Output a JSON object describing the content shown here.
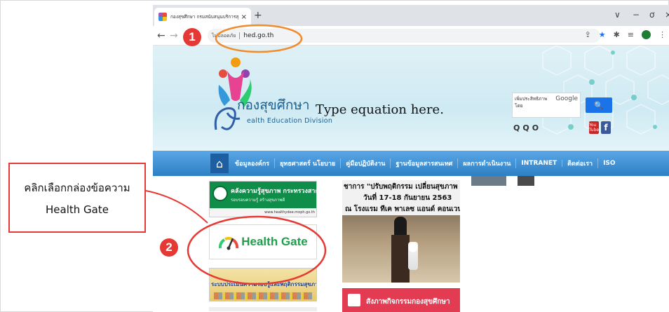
{
  "browser": {
    "tab_title": "กองสุขศึกษา กรมสนับสนุนบริการสุขภ",
    "tab_close": "×",
    "new_tab": "+",
    "window_controls": [
      "∨",
      "−",
      "ơ",
      "×"
    ],
    "nav": {
      "back": "←",
      "forward": "→"
    },
    "security_label": "ไม่ปลอดภัย",
    "url": "hed.go.th",
    "toolbar_icons": [
      "share-icon",
      "star-icon",
      "extension-icon",
      "reading-list-icon",
      "profile-icon",
      "more-icon"
    ]
  },
  "site": {
    "logo_thai": "กองสุขศึกษา",
    "logo_english": "ealth Education Division",
    "equation_placeholder": "Type equation here.",
    "search_placeholder": "เพิ่มประสิทธิภาพโดย",
    "search_brand": "Google",
    "search_button": "🔍",
    "zoom_buttons": [
      "Q",
      "Q",
      "O"
    ],
    "social": {
      "youtube": "You Tube",
      "facebook": "f"
    },
    "menu": [
      "ข้อมูลองค์กร",
      "ยุทธศาสตร์ นโยบาย",
      "คู่มือปฏิบัติงาน",
      "ฐานข้อมูลสารสนเทศ",
      "ผลการดำเนินงาน",
      "INTRANET",
      "ติดต่อเรา",
      "ISO"
    ],
    "left_cards": {
      "card1_title": "คลังความรู้สุขภาพ กระทรวงสาธารณสุข",
      "card1_sub": "รอบรอบความรู้ สร้างสุขภาพดี",
      "card1_url": "www.healthydee.moph.go.th",
      "health_gate": "Health Gate",
      "card3_title": "ระบบประเมินความรอบรู้และพฤติกรรมสุขภาพ"
    },
    "news": {
      "line1": "ชาการ \"ปรับพฤติกรรม เปลี่ยนสุขภาพ",
      "line2": "วันที่ 17-18 กันยายน 2563",
      "line3": "ณ โรงแรม ทีเค พาเลซ แอนด์ คอนเวน"
    },
    "activity_title": "สังภาพกิจกรรมกองสุขศึกษา"
  },
  "annotations": {
    "step1": "1",
    "step2": "2",
    "callout_line1": "คลิกเลือกกล่องข้อความ",
    "callout_line2": "Health Gate",
    "highlight_color": "#e53935",
    "url_ellipse_color": "#f28b2c"
  }
}
